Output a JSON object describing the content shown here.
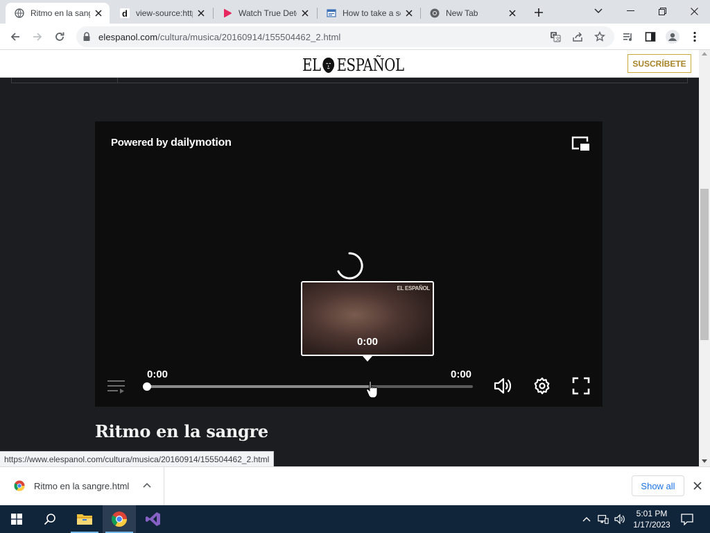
{
  "browser": {
    "tabs": [
      {
        "label": "Ritmo en la sangre",
        "icon": "globe-icon",
        "active": true
      },
      {
        "label": "view-source:https://",
        "icon": "dailymotion-favicon-icon",
        "active": false
      },
      {
        "label": "Watch True Detective",
        "icon": "play-favicon-icon",
        "active": false
      },
      {
        "label": "How to take a screenshot",
        "icon": "page-favicon-icon",
        "active": false
      },
      {
        "label": "New Tab",
        "icon": "chrome-favicon-icon",
        "active": false
      }
    ],
    "address": {
      "host": "elespanol.com",
      "path": "/cultura/musica/20160914/155504462_2.html"
    },
    "status_url": "https://www.elespanol.com/cultura/musica/20160914/155504462_2.html"
  },
  "site": {
    "logo_left": "EL",
    "logo_right": "ESPAÑOL",
    "subscribe_label": "SUSCRÍBETE"
  },
  "player": {
    "powered_prefix": "Powered by",
    "powered_brand": "dailymotion",
    "preview_time": "0:00",
    "preview_watermark": "EL ESPAÑOL",
    "current_time": "0:00",
    "duration": "0:00",
    "played_fraction": 0.0,
    "hover_fraction": 0.68
  },
  "article": {
    "title": "Ritmo en la sangre"
  },
  "downloads": {
    "file_name": "Ritmo en la sangre.html",
    "show_all_label": "Show all"
  },
  "taskbar": {
    "time": "5:01 PM",
    "date": "1/17/2023"
  },
  "colors": {
    "page_background": "#1b1d20",
    "player_background": "#0d0d0d",
    "subscribe_accent": "#c9a93b",
    "link_blue": "#1a73e8",
    "taskbar": "#10243a"
  }
}
